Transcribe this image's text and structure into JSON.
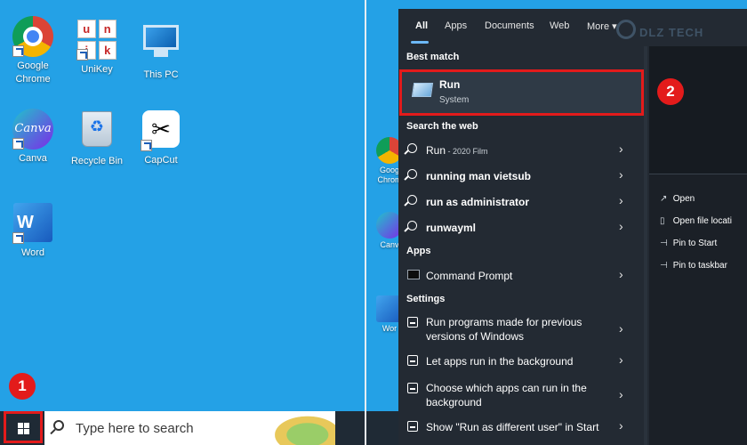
{
  "desktop_left": {
    "icons": [
      {
        "label": "Google\nChrome"
      },
      {
        "label": "UniKey",
        "keys": [
          "u",
          "n",
          "i",
          "k"
        ]
      },
      {
        "label": "This PC"
      },
      {
        "label": "Canva",
        "logo_text": "Canva"
      },
      {
        "label": "Recycle Bin"
      },
      {
        "label": "CapCut",
        "logo_text": "✂"
      },
      {
        "label": "Word",
        "logo_text": "W"
      }
    ],
    "badges": [
      "1",
      "2"
    ]
  },
  "taskbar": {
    "search_placeholder": "Type here to search"
  },
  "start_search": {
    "tabs": [
      "All",
      "Apps",
      "Documents",
      "Web",
      "More ▾"
    ],
    "watermark": "DLZ TECH",
    "best_match": {
      "heading": "Best match",
      "title": "Run",
      "subtitle": "System"
    },
    "web": {
      "heading": "Search the web",
      "items": [
        {
          "prefix": "Run",
          "suffix": " - 2020 Film"
        },
        {
          "text": "running man vietsub"
        },
        {
          "text": "run as administrator"
        },
        {
          "text": "runwayml"
        }
      ]
    },
    "apps": {
      "heading": "Apps",
      "items": [
        {
          "text": "Command Prompt"
        }
      ]
    },
    "settings": {
      "heading": "Settings",
      "items": [
        {
          "text": "Run programs made for previous versions of Windows"
        },
        {
          "text": "Let apps run in the background"
        },
        {
          "text": "Choose which apps can run in the background"
        },
        {
          "text": "Show \"Run as different user\" in Start"
        }
      ]
    },
    "details_actions": [
      "Open",
      "Open file locati",
      "Pin to Start",
      "Pin to taskbar"
    ]
  },
  "desktop_right": {
    "peek_labels": [
      "Goog\nChrom",
      "Canv",
      "Wor"
    ]
  },
  "colors": {
    "desktop": "#24a1e6",
    "taskbar": "#1f2a35",
    "panel": "#232a33",
    "highlight": "#e31b1b",
    "accent": "#6cb8f6"
  }
}
